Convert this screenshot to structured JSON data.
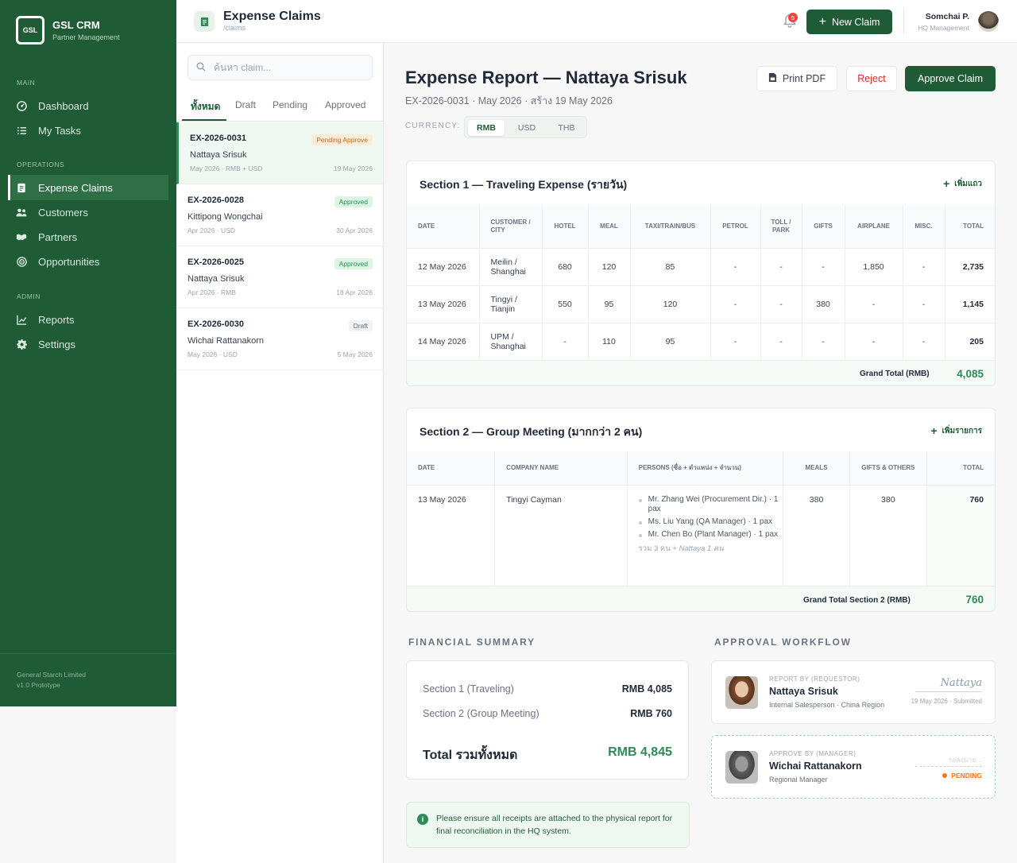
{
  "app": {
    "logo_text": "GSL",
    "name": "GSL CRM",
    "subtitle": "Partner Management"
  },
  "sidebar": {
    "sections": [
      {
        "label": "MAIN",
        "items": [
          {
            "label": "Dashboard",
            "icon": "dashboard-icon"
          },
          {
            "label": "My Tasks",
            "icon": "tasks-icon"
          }
        ]
      },
      {
        "label": "OPERATIONS",
        "items": [
          {
            "label": "Expense Claims",
            "icon": "receipt-icon",
            "active": true
          },
          {
            "label": "Customers",
            "icon": "users-icon"
          },
          {
            "label": "Partners",
            "icon": "handshake-icon"
          },
          {
            "label": "Opportunities",
            "icon": "target-icon"
          }
        ]
      },
      {
        "label": "ADMIN",
        "items": [
          {
            "label": "Reports",
            "icon": "chart-icon"
          },
          {
            "label": "Settings",
            "icon": "gear-icon"
          }
        ]
      }
    ],
    "footer_company": "General Starch Limited",
    "footer_version": "v1.0 Prototype"
  },
  "topbar": {
    "title": "Expense Claims",
    "path": "/claims",
    "notification_count": "5",
    "new_claim_label": "New Claim",
    "user_name": "Somchai P.",
    "user_role": "HQ Management"
  },
  "claims_list": {
    "search_placeholder": "ค้นหา claim...",
    "tabs": [
      "ทั้งหมด",
      "Draft",
      "Pending",
      "Approved"
    ],
    "active_tab": 0,
    "items": [
      {
        "id": "EX-2026-0031",
        "name": "Nattaya Srisuk",
        "meta": "May 2026 · RMB + USD",
        "date": "19 May 2026",
        "status": "Pending Approve",
        "status_type": "pending",
        "active": true
      },
      {
        "id": "EX-2026-0028",
        "name": "Kittipong Wongchai",
        "meta": "Apr 2026 · USD",
        "date": "30 Apr 2026",
        "status": "Approved",
        "status_type": "approved"
      },
      {
        "id": "EX-2026-0025",
        "name": "Nattaya Srisuk",
        "meta": "Apr 2026 · RMB",
        "date": "18 Apr 2026",
        "status": "Approved",
        "status_type": "approved"
      },
      {
        "id": "EX-2026-0030",
        "name": "Wichai Rattanakorn",
        "meta": "May 2026 · USD",
        "date": "5 May 2026",
        "status": "Draft",
        "status_type": "draft"
      }
    ]
  },
  "report": {
    "title": "Expense Report — Nattaya Srisuk",
    "subtitle": "EX-2026-0031 · May 2026 · สร้าง 19 May 2026",
    "print_label": "Print PDF",
    "reject_label": "Reject",
    "approve_label": "Approve Claim",
    "currency_label": "CURRENCY:",
    "currencies": [
      "RMB",
      "USD",
      "THB"
    ],
    "active_currency": 0
  },
  "section1": {
    "title": "Section 1 — Traveling Expense (รายวัน)",
    "add_label": "เพิ่มแถว",
    "headers": [
      "DATE",
      "CUSTOMER / CITY",
      "HOTEL",
      "MEAL",
      "TAXI/TRAIN/BUS",
      "PETROL",
      "TOLL / PARK",
      "GIFTS",
      "AIRPLANE",
      "MISC.",
      "TOTAL"
    ],
    "rows": [
      [
        "12 May 2026",
        "Meilin / Shanghai",
        "680",
        "120",
        "85",
        "-",
        "-",
        "-",
        "1,850",
        "-",
        "2,735"
      ],
      [
        "13 May 2026",
        "Tingyi / Tianjin",
        "550",
        "95",
        "120",
        "-",
        "-",
        "380",
        "-",
        "-",
        "1,145"
      ],
      [
        "14 May 2026",
        "UPM / Shanghai",
        "-",
        "110",
        "95",
        "-",
        "-",
        "-",
        "-",
        "-",
        "205"
      ]
    ],
    "grand_total_label": "Grand Total (RMB)",
    "grand_total": "4,085"
  },
  "section2": {
    "title": "Section 2 — Group Meeting (มากกว่า 2 คน)",
    "add_label": "เพิ่มรายการ",
    "headers": [
      "DATE",
      "COMPANY NAME",
      "PERSONS (ชื่อ + ตำแหน่ง + จำนวน)",
      "MEALS",
      "GIFTS & OTHERS",
      "TOTAL"
    ],
    "row": {
      "date": "13 May 2026",
      "company": "Tingyi Cayman",
      "persons": [
        "Mr. Zhang Wei (Procurement Dir.) · 1 pax",
        "Ms. Liu Yang (QA Manager) · 1 pax",
        "Mr. Chen Bo (Plant Manager) · 1 pax"
      ],
      "persons_total_prefix": "รวม 3 คน + ",
      "persons_total_suffix": "Nattaya 1 คน",
      "meals": "380",
      "gifts": "380",
      "total": "760"
    },
    "grand_total_label": "Grand Total Section 2 (RMB)",
    "grand_total": "760"
  },
  "summary": {
    "title": "FINANCIAL SUMMARY",
    "rows": [
      {
        "label": "Section 1 (Traveling)",
        "value": "RMB 4,085"
      },
      {
        "label": "Section 2 (Group Meeting)",
        "value": "RMB 760"
      }
    ],
    "total_label": "Total รวมทั้งหมด",
    "total_value": "RMB 4,845",
    "note": "Please ensure all receipts are attached to the physical report for final reconciliation in the HQ system."
  },
  "workflow": {
    "title": "APPROVAL WORKFLOW",
    "steps": [
      {
        "role": "REPORT BY (REQUESTOR)",
        "name": "Nattaya Srisuk",
        "position": "Internal Salesperson · China Region",
        "signature": "Nattaya",
        "status": "19 May 2026 · Submitted"
      },
      {
        "role": "APPROVE BY (MANAGER)",
        "name": "Wichai Rattanakorn",
        "position": "Regional Manager",
        "waiting": "รอลงนาม...",
        "status": "PENDING"
      }
    ]
  },
  "colors": {
    "brand": "#1f5c35",
    "accent": "#2e8b57",
    "danger": "#dc2626",
    "pending": "#f97316"
  }
}
